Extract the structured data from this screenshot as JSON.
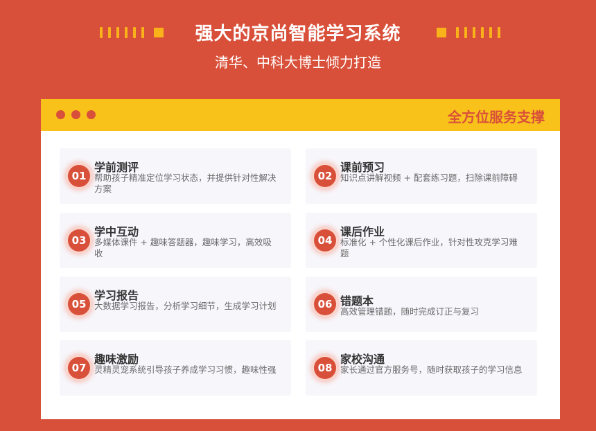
{
  "header": {
    "title": "强大的京尚智能学习系统",
    "subtitle": "清华、中科大博士倾力打造"
  },
  "panel": {
    "title": "全方位服务支撑"
  },
  "features": [
    {
      "num": "01",
      "title": "学前测评",
      "desc": "帮助孩子精准定位学习状态，并提供针对性解决方案"
    },
    {
      "num": "02",
      "title": "课前预习",
      "desc": "知识点讲解视频 + 配套练习题，扫除课前障碍"
    },
    {
      "num": "03",
      "title": "学中互动",
      "desc": "多媒体课件 + 趣味答题器，趣味学习，高效吸收"
    },
    {
      "num": "04",
      "title": "课后作业",
      "desc": "标准化 + 个性化课后作业，针对性攻克学习难题"
    },
    {
      "num": "05",
      "title": "学习报告",
      "desc": "大数据学习报告，分析学习细节，生成学习计划"
    },
    {
      "num": "06",
      "title": "错题本",
      "desc": "高效管理错题，随时完成订正与复习"
    },
    {
      "num": "07",
      "title": "趣味激励",
      "desc": "灵精灵宠系统引导孩子养成学习习惯，趣味性强"
    },
    {
      "num": "08",
      "title": "家校沟通",
      "desc": "家长通过官方服务号，随时获取孩子的学习信息"
    }
  ],
  "colors": {
    "background": "#d9503a",
    "accent_yellow": "#f9c21b",
    "badge_red": "#d9503a"
  }
}
